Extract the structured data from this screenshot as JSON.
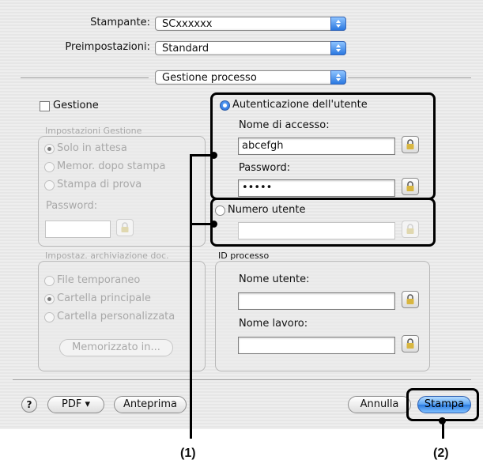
{
  "printer": {
    "label": "Stampante:",
    "value": "SCxxxxxx"
  },
  "presets": {
    "label": "Preimpostazioni:",
    "value": "Standard"
  },
  "section": {
    "value": "Gestione processo"
  },
  "gestione": {
    "checkbox_label": "Gestione",
    "settings_title": "Impostazioni Gestione",
    "options": [
      "Solo in attesa",
      "Memor. dopo stampa",
      "Stampa di prova"
    ],
    "password_label": "Password:"
  },
  "archive": {
    "title": "Impostaz. archiviazione doc.",
    "options": [
      "File temporaneo",
      "Cartella principale",
      "Cartella personalizzata"
    ],
    "button": "Memorizzato in..."
  },
  "auth": {
    "radio_label": "Autenticazione dell'utente",
    "login_label": "Nome di accesso:",
    "login_value": "abcefgh",
    "password_label": "Password:",
    "password_value": "•••••",
    "user_number_label": "Numero utente"
  },
  "job_id": {
    "title": "ID processo",
    "user_name_label": "Nome utente:",
    "job_name_label": "Nome lavoro:"
  },
  "footer": {
    "help": "?",
    "pdf": "PDF ▾",
    "preview": "Anteprima",
    "cancel": "Annulla",
    "print": "Stampa"
  },
  "callouts": [
    "(1)",
    "(2)"
  ]
}
